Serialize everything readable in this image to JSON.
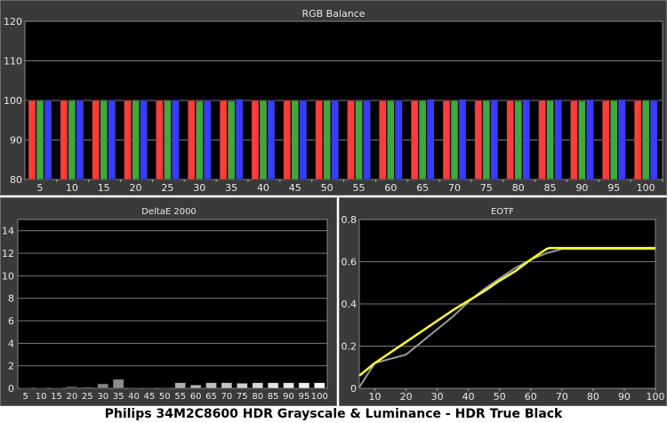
{
  "footer": "Philips 34M2C8600 HDR Grayscale & Luminance - HDR True Black",
  "chart_data": [
    {
      "type": "bar",
      "title": "RGB Balance",
      "categories": [
        "5",
        "10",
        "15",
        "20",
        "25",
        "30",
        "35",
        "40",
        "45",
        "50",
        "55",
        "60",
        "65",
        "70",
        "75",
        "80",
        "85",
        "90",
        "95",
        "100"
      ],
      "ylim": [
        80,
        120
      ],
      "yticks": [
        80,
        90,
        100,
        110,
        120
      ],
      "grid": true,
      "colors": {
        "red": "#ff3b3b",
        "green": "#3fa83f",
        "blue": "#3b3bff"
      },
      "series": [
        {
          "values": [
            100,
            100,
            100,
            100,
            100,
            100,
            100,
            100,
            100,
            100,
            100,
            100,
            100,
            100,
            100,
            100,
            100,
            100,
            100,
            100
          ]
        },
        {
          "values": [
            100,
            100,
            100,
            100,
            100,
            99.8,
            99.8,
            100,
            100,
            100,
            99.8,
            100,
            100,
            100,
            100,
            99.8,
            100,
            99.8,
            100,
            100
          ]
        },
        {
          "values": [
            100,
            100,
            100,
            100,
            100,
            100,
            100.3,
            100,
            100,
            100,
            100,
            100,
            100.3,
            100.3,
            100.2,
            100.2,
            100.2,
            100.2,
            100.2,
            100
          ]
        }
      ]
    },
    {
      "type": "bar",
      "title": "DeltaE 2000",
      "categories": [
        "5",
        "10",
        "15",
        "20",
        "25",
        "30",
        "35",
        "40",
        "45",
        "50",
        "55",
        "60",
        "65",
        "70",
        "75",
        "80",
        "85",
        "90",
        "95",
        "100"
      ],
      "ylim": [
        0,
        15
      ],
      "yticks": [
        0,
        2,
        4,
        6,
        8,
        10,
        12,
        14
      ],
      "grid": true,
      "values": [
        0.05,
        0.05,
        0.05,
        0.15,
        0.1,
        0.4,
        0.8,
        0.05,
        0.05,
        0.05,
        0.5,
        0.3,
        0.5,
        0.5,
        0.45,
        0.5,
        0.5,
        0.5,
        0.5,
        0.5
      ]
    },
    {
      "type": "line",
      "title": "EOTF",
      "xlim": [
        5,
        100
      ],
      "ylim": [
        0,
        0.8
      ],
      "xticks": [
        10,
        20,
        30,
        40,
        50,
        60,
        70,
        80,
        90,
        100
      ],
      "yticks": [
        0,
        0.2,
        0.4,
        0.6,
        0.8
      ],
      "grid": true,
      "series": [
        {
          "color": "#9a9a9a",
          "x": [
            5,
            10,
            15,
            20,
            25,
            30,
            35,
            40,
            45,
            50,
            55,
            60,
            65,
            70,
            75,
            80,
            85,
            90,
            95,
            100
          ],
          "y": [
            0.005,
            0.12,
            0.14,
            0.16,
            0.22,
            0.28,
            0.34,
            0.41,
            0.47,
            0.52,
            0.57,
            0.61,
            0.64,
            0.66,
            0.66,
            0.66,
            0.66,
            0.66,
            0.66,
            0.66
          ]
        },
        {
          "color": "#ffff33",
          "x": [
            5,
            10,
            15,
            20,
            25,
            30,
            35,
            40,
            45,
            50,
            55,
            60,
            65,
            66,
            70,
            75,
            80,
            85,
            90,
            95,
            100
          ],
          "y": [
            0.06,
            0.12,
            0.17,
            0.22,
            0.27,
            0.32,
            0.37,
            0.415,
            0.46,
            0.51,
            0.555,
            0.61,
            0.66,
            0.665,
            0.665,
            0.665,
            0.665,
            0.665,
            0.665,
            0.665,
            0.665
          ]
        }
      ]
    }
  ]
}
